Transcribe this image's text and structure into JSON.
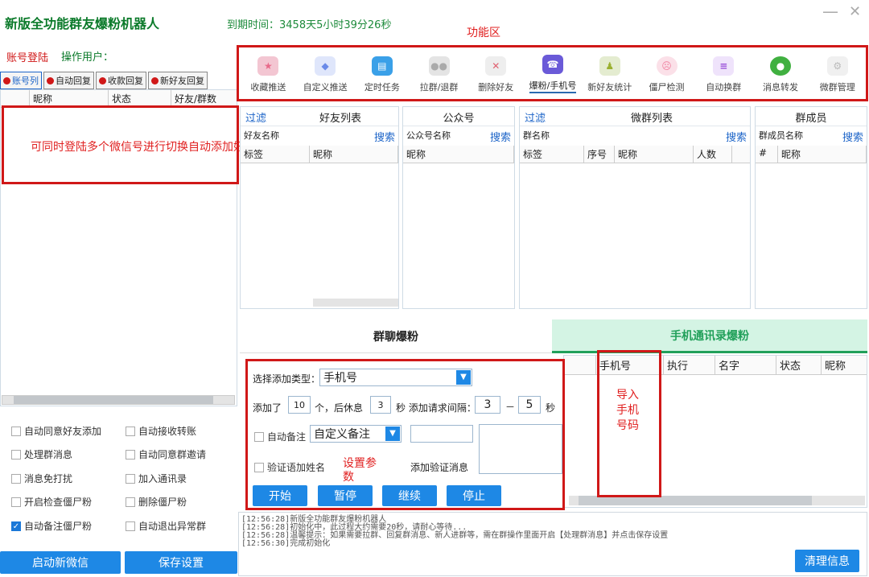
{
  "app": {
    "title": "新版全功能群友爆粉机器人",
    "expire": "到期时间：3458天5小时39分26秒",
    "minimize": "—",
    "close": "✕"
  },
  "annotations": {
    "function_area": "功能区",
    "multi_login": "可同时登陆多个微信号进行切换自动添加好友",
    "import_phone": "导入手机号码",
    "set_params": "设置参数"
  },
  "account": {
    "login_label": "账号登陆",
    "operator_label": "操作用户：",
    "tabs": [
      "账号列",
      "自动回复",
      "收款回复",
      "新好友回复"
    ],
    "columns": [
      "昵称",
      "状态",
      "好友/群数"
    ]
  },
  "options": [
    {
      "label": "自动同意好友添加",
      "checked": false
    },
    {
      "label": "自动接收转账",
      "checked": false
    },
    {
      "label": "处理群消息",
      "checked": false
    },
    {
      "label": "自动同意群邀请",
      "checked": false
    },
    {
      "label": "消息免打扰",
      "checked": false
    },
    {
      "label": "加入通讯录",
      "checked": false
    },
    {
      "label": "开启检查僵尸粉",
      "checked": false
    },
    {
      "label": "删除僵尸粉",
      "checked": false
    },
    {
      "label": "自动备注僵尸粉",
      "checked": true
    },
    {
      "label": "自动退出异常群",
      "checked": false
    }
  ],
  "bottom_buttons": {
    "new_wechat": "启动新微信",
    "save_settings": "保存设置"
  },
  "toolbar": [
    {
      "label": "收藏推送",
      "icon": "star-icon",
      "color": "#e86a8a"
    },
    {
      "label": "自定义推送",
      "icon": "send-icon",
      "color": "#6a8ae8"
    },
    {
      "label": "定时任务",
      "icon": "schedule-icon",
      "color": "#3aa0e8"
    },
    {
      "label": "拉群/退群",
      "icon": "group-icon",
      "color": "#b0b0b0"
    },
    {
      "label": "删除好友",
      "icon": "delete-friend-icon",
      "color": "#c0c0c0"
    },
    {
      "label": "爆粉/手机号",
      "icon": "phone-contact-icon",
      "color": "#6a5ad8"
    },
    {
      "label": "新好友统计",
      "icon": "new-friend-icon",
      "color": "#9ab030"
    },
    {
      "label": "僵尸检测",
      "icon": "zombie-icon",
      "color": "#f080a0"
    },
    {
      "label": "自动换群",
      "icon": "switch-group-icon",
      "color": "#9a50d8"
    },
    {
      "label": "消息转发",
      "icon": "forward-icon",
      "color": "#40b040"
    },
    {
      "label": "微群管理",
      "icon": "settings-icon",
      "color": "#c0c0c0"
    }
  ],
  "friends": {
    "filter": "过滤",
    "title": "好友列表",
    "name_label": "好友名称",
    "search": "搜索",
    "cols": [
      "标签",
      "昵称"
    ]
  },
  "official": {
    "title": "公众号",
    "name_label": "公众号名称",
    "search": "搜索",
    "cols": [
      "昵称"
    ]
  },
  "groups": {
    "filter": "过滤",
    "title": "微群列表",
    "name_label": "群名称",
    "search": "搜索",
    "cols": [
      "标签",
      "序号",
      "昵称",
      "人数"
    ]
  },
  "members": {
    "title": "群成员",
    "name_label": "群成员名称",
    "search": "搜索",
    "cols": [
      "#",
      "昵称"
    ]
  },
  "bottom_tabs": {
    "group_fans": "群聊爆粉",
    "contact_fans": "手机通讯录爆粉"
  },
  "form": {
    "type_label": "选择添加类型：",
    "type_value": "手机号",
    "added_prefix": "添加了",
    "count": "10",
    "rest_mid": "个，后休息",
    "rest": "3",
    "interval_label": "秒 添加请求间隔：",
    "min": "3",
    "dash": "－",
    "max": "5",
    "sec": "秒",
    "remark_label": "自动备注",
    "remark_value": "自定义备注",
    "verify_name": "验证语加姓名",
    "verify_msg": "添加验证消息"
  },
  "actions": {
    "start": "开始",
    "pause": "暂停",
    "resume": "继续",
    "stop": "停止"
  },
  "phone_table": {
    "cols": [
      "手机号",
      "执行",
      "名字",
      "状态",
      "昵称"
    ]
  },
  "log": [
    "[12:56:28]新版全功能群友爆粉机器人",
    "[12:56:28]初始化中，此过程大约需要20秒，请耐心等待...",
    "[12:56:28]温馨提示：如果需要拉群、回复群消息、新人进群等，需在群操作里面开启【处理群消息】并点击保存设置",
    "[12:56:30]完成初始化"
  ],
  "clear_btn": "清理信息"
}
